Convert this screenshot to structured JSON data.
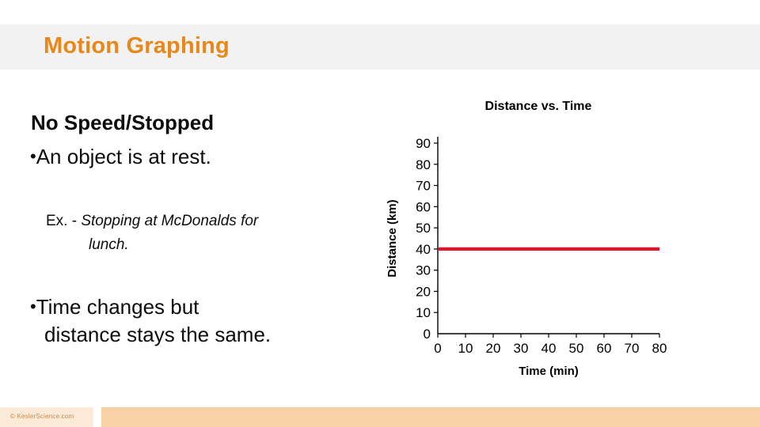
{
  "header": {
    "title": "Motion Graphing",
    "accent_color": "#e8881a",
    "band_color": "#f2f2f2"
  },
  "content": {
    "heading": "No Speed/Stopped",
    "bullet_dot": "•",
    "bullet_one": "An object is at rest.",
    "example": {
      "label": "Ex. - ",
      "italic_line_1": "Stopping at McDonalds for",
      "italic_line_2": "lunch."
    },
    "bullet_two_line_1": "Time changes but",
    "bullet_two_line_2": "distance stays the same."
  },
  "chart_data": {
    "type": "line",
    "title": "Distance vs. Time",
    "xlabel": "Time (min)",
    "ylabel": "Distance (km)",
    "xlim": [
      0,
      80
    ],
    "ylim": [
      0,
      90
    ],
    "xticks": [
      "0",
      "10",
      "20",
      "30",
      "40",
      "50",
      "60",
      "70",
      "80"
    ],
    "yticks": [
      "0",
      "10",
      "20",
      "30",
      "40",
      "50",
      "60",
      "70",
      "80",
      "90"
    ],
    "grid": false,
    "legend": "none",
    "series": [
      {
        "name": "Distance",
        "color": "#e8102a",
        "x": [
          0,
          80
        ],
        "values": [
          40,
          40
        ]
      }
    ]
  },
  "footer": {
    "copyright": "© KeslerScience.com",
    "left_band_color": "#fbead8",
    "right_band_color": "#f8d2a4"
  }
}
